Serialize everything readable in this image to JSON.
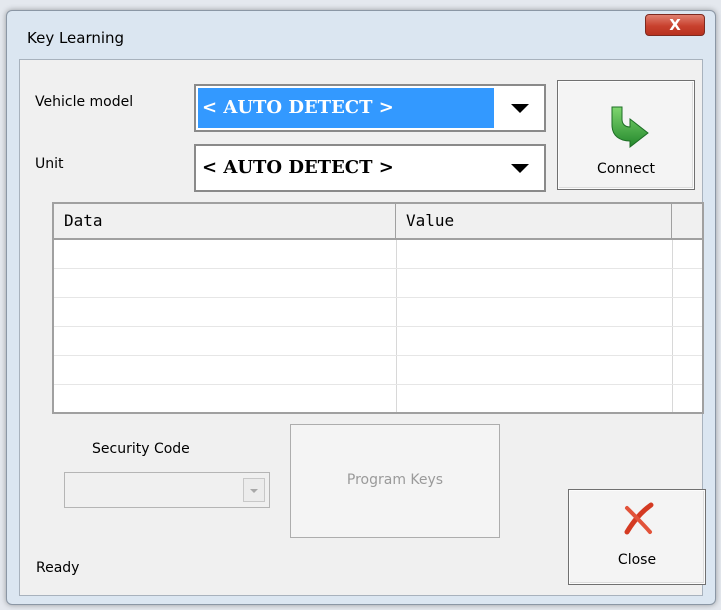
{
  "window": {
    "title": "Key Learning",
    "close_glyph": "X"
  },
  "vehicle_model": {
    "label": "Vehicle model",
    "value": "< AUTO DETECT >"
  },
  "unit": {
    "label": "Unit",
    "value": "< AUTO DETECT >"
  },
  "connect": {
    "label": "Connect",
    "icon": "green-arrow-icon",
    "icon_color": "#2f9e3a"
  },
  "grid": {
    "columns": [
      "Data",
      "Value"
    ],
    "rows": []
  },
  "security": {
    "label": "Security Code",
    "value": ""
  },
  "program_keys": {
    "label": "Program Keys"
  },
  "close": {
    "label": "Close",
    "icon": "red-x-icon",
    "icon_color": "#d43a22"
  },
  "status": {
    "text": "Ready"
  },
  "colors": {
    "selection": "#3399ff",
    "client_bg": "#f0f0f0",
    "frame_bg": "#dbe6f1"
  }
}
